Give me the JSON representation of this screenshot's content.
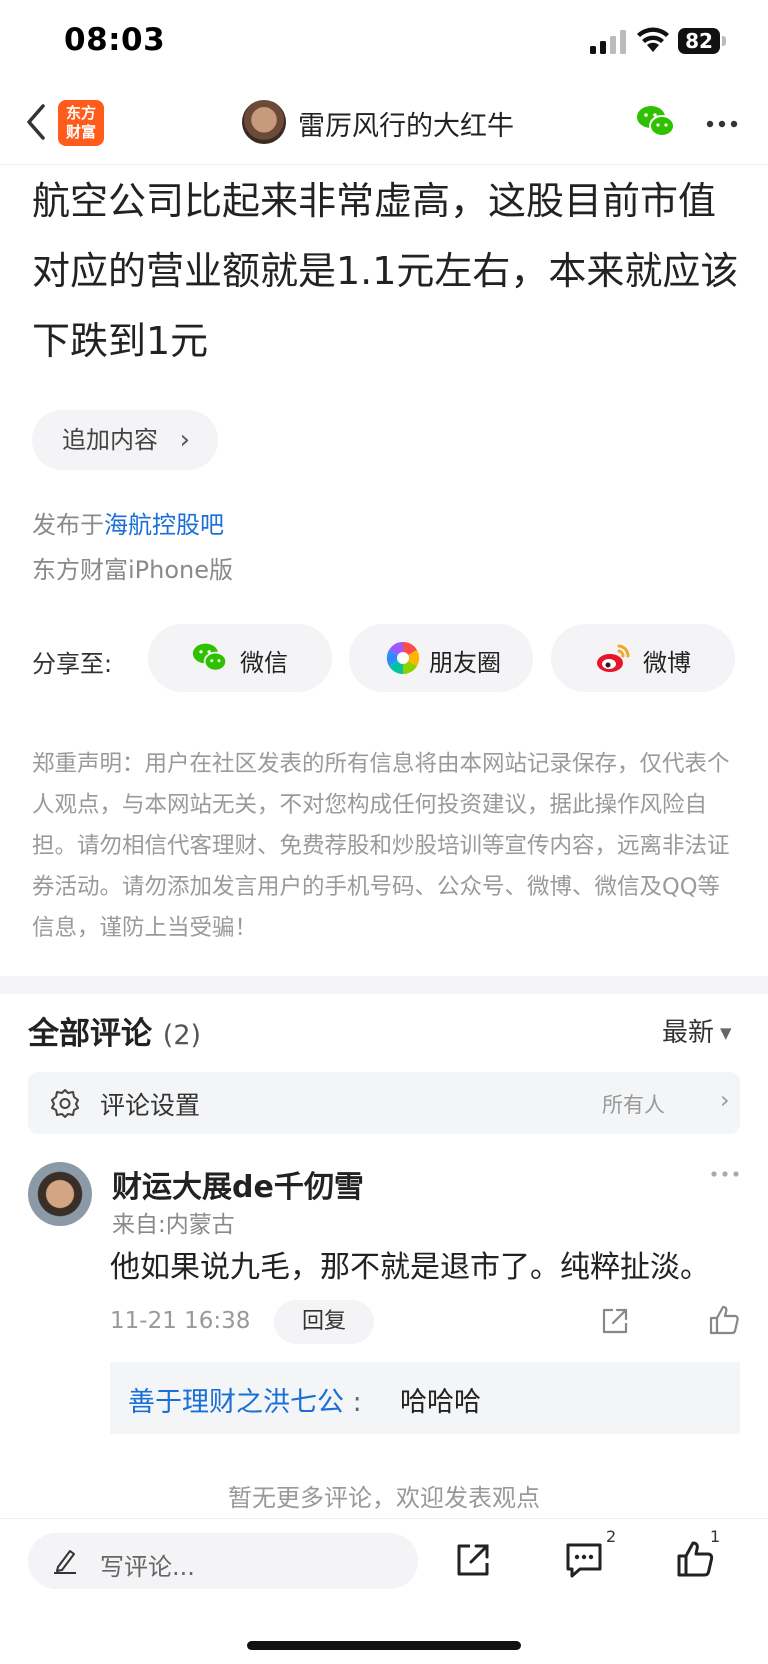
{
  "status_bar": {
    "time": "08:03",
    "battery": "82"
  },
  "nav": {
    "logo_line1": "东方",
    "logo_line2": "财富",
    "title": "雷厉风行的大红牛"
  },
  "post": {
    "body": "航空公司比起来非常虚高，这股目前市值对应的营业额就是1.1元左右，本来就应该下跌到1元",
    "add_content_label": "追加内容",
    "published_prefix": "发布于",
    "published_forum": "海航控股吧",
    "source": "东方财富iPhone版"
  },
  "share": {
    "label": "分享至:",
    "buttons": [
      {
        "label": "微信",
        "icon": "wechat-icon"
      },
      {
        "label": "朋友圈",
        "icon": "moments-icon"
      },
      {
        "label": "微博",
        "icon": "weibo-icon"
      }
    ]
  },
  "disclaimer": "郑重声明：用户在社区发表的所有信息将由本网站记录保存，仅代表个人观点，与本网站无关，不对您构成任何投资建议，据此操作风险自担。请勿相信代客理财、免费荐股和炒股培训等宣传内容，远离非法证券活动。请勿添加发言用户的手机号码、公众号、微博、微信及QQ等信息，谨防上当受骗！",
  "comments": {
    "title": "全部评论",
    "count": "(2)",
    "sort": "最新",
    "settings_label": "评论设置",
    "settings_value": "所有人",
    "items": [
      {
        "user": "财运大展de千仞雪",
        "location": "来自:内蒙古",
        "text": "他如果说九毛，那不就是退市了。纯粹扯淡。",
        "time": "11-21 16:38",
        "reply_label": "回复",
        "sub_reply": {
          "user": "善于理财之洪七公",
          "sep": ":",
          "text": "哈哈哈"
        }
      }
    ],
    "no_more": "暂无更多评论，欢迎发表观点"
  },
  "bottom_bar": {
    "placeholder": "写评论...",
    "comment_count": "2",
    "like_count": "1"
  },
  "colors": {
    "accent_blue": "#1a6fd7",
    "logo_orange": "#ff5b1b",
    "wechat_green": "#2dc100"
  }
}
